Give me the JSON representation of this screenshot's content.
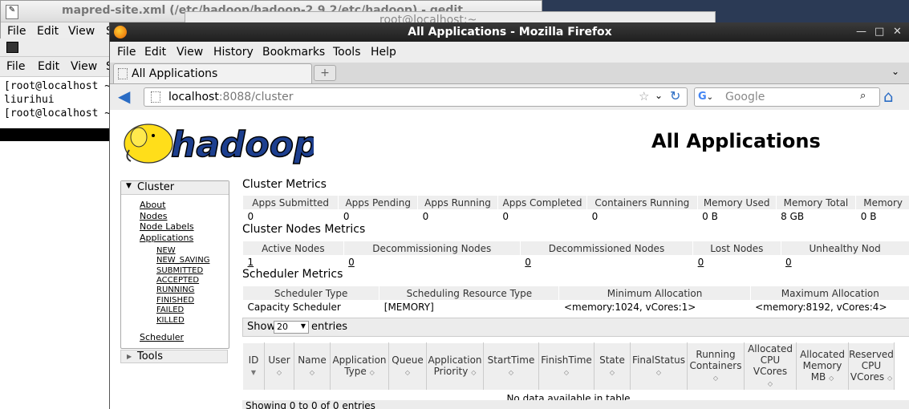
{
  "gedit": {
    "title": "mapred-site.xml (/etc/hadoop/hadoop-2.9.2/etc/hadoop) - gedit",
    "menu": [
      "File",
      "Edit",
      "View",
      "S"
    ]
  },
  "terminal": {
    "menu": [
      "File",
      "Edit",
      "View",
      "S"
    ],
    "lines": [
      "[root@localhost ~",
      "liurihui",
      "[root@localhost ~"
    ]
  },
  "terminal2": {
    "title": "root@localhost:~"
  },
  "firefox": {
    "title": "All Applications - Mozilla Firefox",
    "menu": [
      "File",
      "Edit",
      "View",
      "History",
      "Bookmarks",
      "Tools",
      "Help"
    ],
    "tab": "All Applications",
    "url_host": "localhost",
    "url_path": ":8088/cluster",
    "search_placeholder": "Google"
  },
  "page": {
    "title": "All Applications",
    "nav_header": "Cluster",
    "nav_links": [
      "About",
      "Nodes",
      "Node Labels",
      "Applications"
    ],
    "nav_sublinks": [
      "NEW",
      "NEW_SAVING",
      "SUBMITTED",
      "ACCEPTED",
      "RUNNING",
      "FINISHED",
      "FAILED",
      "KILLED"
    ],
    "nav_scheduler": "Scheduler",
    "nav_tools": "Tools",
    "cluster_metrics": {
      "heading": "Cluster Metrics",
      "headers": [
        "Apps Submitted",
        "Apps Pending",
        "Apps Running",
        "Apps Completed",
        "Containers Running",
        "Memory Used",
        "Memory Total",
        "Memory"
      ],
      "values": [
        "0",
        "0",
        "0",
        "0",
        "0",
        "0 B",
        "8 GB",
        "0 B"
      ]
    },
    "node_metrics": {
      "heading": "Cluster Nodes Metrics",
      "headers": [
        "Active Nodes",
        "Decommissioning Nodes",
        "Decommissioned Nodes",
        "Lost Nodes",
        "Unhealthy Nod"
      ],
      "values": [
        "1",
        "0",
        "0",
        "0",
        "0"
      ]
    },
    "scheduler_metrics": {
      "heading": "Scheduler Metrics",
      "headers": [
        "Scheduler Type",
        "Scheduling Resource Type",
        "Minimum Allocation",
        "Maximum Allocation"
      ],
      "values": [
        "Capacity Scheduler",
        "[MEMORY]",
        "<memory:1024, vCores:1>",
        "<memory:8192, vCores:4>"
      ]
    },
    "show_label": "Show",
    "show_value": "20",
    "entries_label": "entries",
    "apps_table": {
      "headers": [
        "ID",
        "User",
        "Name",
        "Application Type",
        "Queue",
        "Application Priority",
        "StartTime",
        "FinishTime",
        "State",
        "FinalStatus",
        "Running Containers",
        "Allocated CPU VCores",
        "Allocated Memory MB",
        "Reserved CPU VCores"
      ],
      "empty": "No data available in table"
    },
    "footer": "Showing 0 to 0 of 0 entries"
  }
}
